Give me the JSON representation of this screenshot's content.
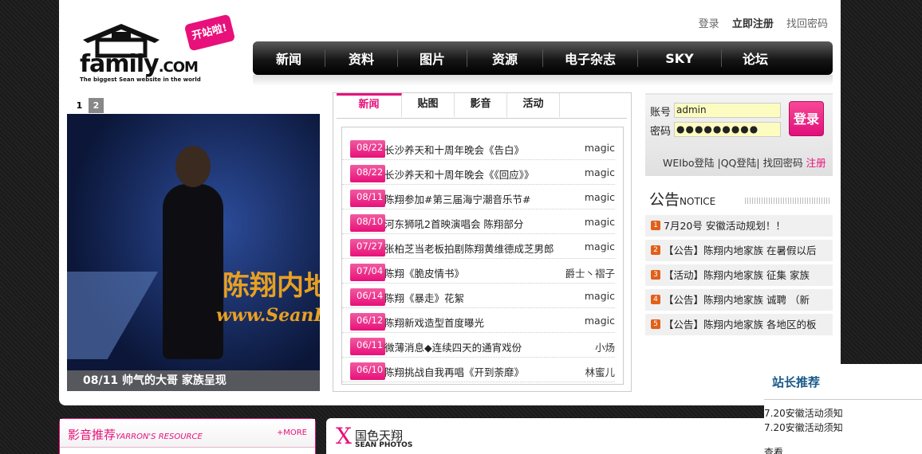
{
  "header": {
    "logo_brand": "sean family.com",
    "logo_tagline": "The biggest Sean website in the world",
    "logo_sticker": "开站啦!",
    "top_links": [
      "登录",
      "立即注册",
      "找回密码"
    ]
  },
  "nav": [
    "新闻",
    "资料",
    "图片",
    "资源",
    "电子杂志",
    "SKY",
    "论坛"
  ],
  "slideshow": {
    "tabs": [
      "1",
      "2"
    ],
    "watermark_cn": "陈翔内地",
    "watermark_en": "www.SeanF",
    "caption": "08/11 帅气的大哥 家族呈现"
  },
  "news": {
    "tabs": [
      "新闻",
      "贴图",
      "影音",
      "活动"
    ],
    "rows": [
      {
        "date": "08/22",
        "title": "长沙养天和十周年晚会《告白》",
        "author": "magic"
      },
      {
        "date": "08/22",
        "title": "长沙养天和十周年晚会《《回应》》",
        "author": "magic"
      },
      {
        "date": "08/11",
        "title": "陈翔参加#第三届海宁潮音乐节#",
        "author": "magic"
      },
      {
        "date": "08/10",
        "title": "河东狮吼2首映演唱会 陈翔部分",
        "author": "magic"
      },
      {
        "date": "07/27",
        "title": "张柏芝当老板拍剧陈翔黄维德成芝男郎",
        "author": "magic"
      },
      {
        "date": "07/04",
        "title": "陈翔《脆皮情书》",
        "author": "爵士丶褶子"
      },
      {
        "date": "06/14",
        "title": "陈翔《暴走》花絮",
        "author": "magic"
      },
      {
        "date": "06/12",
        "title": "陈翔新戏造型首度曝光",
        "author": "magic"
      },
      {
        "date": "06/11",
        "title": "微薄消息◆连续四天的通宵戏份",
        "author": "小炀"
      },
      {
        "date": "06/10",
        "title": "陈翔挑战自我再唱《开到荼靡》",
        "author": "林蜜儿"
      }
    ]
  },
  "login": {
    "account_label": "账号",
    "password_label": "密码",
    "account_value": "admin",
    "password_value": "●●●●●●●●●",
    "login_button": "登录",
    "links_text": "WEIbo登陆 |QQ登陆| 找回密码",
    "register": "注册"
  },
  "notice": {
    "title_cn": "公告",
    "title_en": "NOTICE",
    "items": [
      {
        "num": "1",
        "text": "7月20号 安徽活动规划！！"
      },
      {
        "num": "2",
        "text": "【公告】陈翔内地家族 在暑假以后"
      },
      {
        "num": "3",
        "text": "【活动】陈翔内地家族 征集 家族"
      },
      {
        "num": "4",
        "text": "【公告】陈翔内地家族 诚聘 （新"
      },
      {
        "num": "5",
        "text": "【公告】陈翔内地家族 各地区的板"
      }
    ]
  },
  "av_section": {
    "title": "影音推荐",
    "title_en": "YARRON'S RESOURCE",
    "more": "+MORE"
  },
  "photos_section": {
    "x": "X",
    "title": "国色天翔",
    "title_en": "SEAN PHOTOS"
  },
  "recommend": {
    "title": "站长推荐",
    "items": [
      "7.20安徽活动须知",
      "7.20安徽活动须知",
      "查看"
    ]
  }
}
